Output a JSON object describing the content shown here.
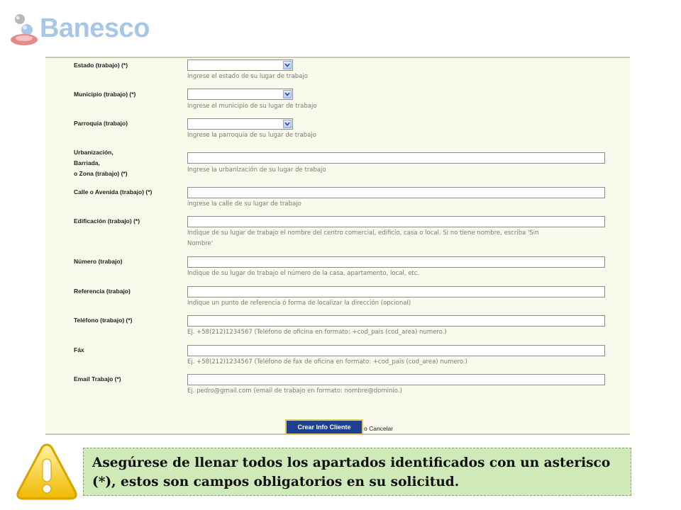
{
  "brand": {
    "name": "Banesco"
  },
  "form": {
    "fields": [
      {
        "label": "Estado (trabajo) (*)",
        "type": "select",
        "hint": "Ingrese el estado de su lugar de trabajo"
      },
      {
        "label": "Municipio (trabajo) (*)",
        "type": "select",
        "hint": "Ingrese el municipio de su lugar de trabajo"
      },
      {
        "label": "Parroquia (trabajo)",
        "type": "select",
        "hint": "Ingrese la parroquia de su lugar de trabajo"
      },
      {
        "label_lines": [
          "Urbanización,",
          "Barriada,",
          "o Zona (trabajo) (*)"
        ],
        "type": "text",
        "hint": "Ingrese la urbanización de su lugar de trabajo"
      },
      {
        "label": "Calle o Avenida (trabajo) (*)",
        "type": "text",
        "hint": "ingrese la calle de su lugar de trabajo"
      },
      {
        "label": "Edificación (trabajo) (*)",
        "type": "text",
        "hint_lines": [
          "Indique de su lugar de trabajo el nombre del centro comercial, edificio, casa o local. Si no tiene nombre, escriba 'Sin",
          "Nombre'"
        ]
      },
      {
        "label": "Número (trabajo)",
        "type": "text",
        "hint": "Indique de su lugar de trabajo el número de la casa, apartamento, local, etc."
      },
      {
        "label": "Referencia (trabajo)",
        "type": "text",
        "hint": "Indique un punto de referencia ó forma de localizar la dirección (opcional)"
      },
      {
        "label": "Teléfono (trabajo) (*)",
        "type": "text",
        "hint": "Ej. +58(212)1234567 (Teléfono de oficina en formato: +cod_pais (cod_area) numero.)"
      },
      {
        "label": "Fáx",
        "type": "text",
        "hint": "Ej. +58(212)1234567 (Teléfono de fax de oficina en formato: +cod_pais (cod_area) numero.)"
      },
      {
        "label": "Email Trabajo (*)",
        "type": "text",
        "hint": "Ej. pedro@gmail.com (email de trabajo en formato: nombre@dominio.)"
      }
    ],
    "submit_label": "Crear Info Cliente",
    "cancel_label": "o Cancelar"
  },
  "note": {
    "icon": "warning-icon",
    "text": "Asegúrese de llenar todos los apartados identificados con un asterisco (*), estos son campos obligatorios en su solicitud."
  }
}
